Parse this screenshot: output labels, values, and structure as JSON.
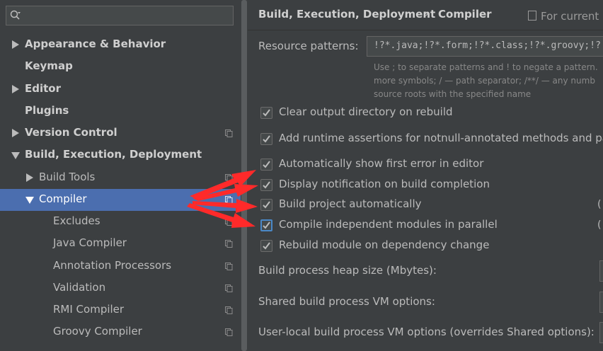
{
  "search": {
    "value": "",
    "placeholder": ""
  },
  "sidebar": {
    "items": [
      {
        "label": "Appearance & Behavior"
      },
      {
        "label": "Keymap"
      },
      {
        "label": "Editor"
      },
      {
        "label": "Plugins"
      },
      {
        "label": "Version Control"
      },
      {
        "label": "Build, Execution, Deployment"
      },
      {
        "label": "Build Tools"
      },
      {
        "label": "Compiler"
      },
      {
        "label": "Excludes"
      },
      {
        "label": "Java Compiler"
      },
      {
        "label": "Annotation Processors"
      },
      {
        "label": "Validation"
      },
      {
        "label": "RMI Compiler"
      },
      {
        "label": "Groovy Compiler"
      }
    ]
  },
  "breadcrumb": {
    "parent": "Build, Execution, Deployment",
    "separator": "›",
    "current": "Compiler",
    "scope": "For current"
  },
  "resource_patterns": {
    "label": "Resource patterns:",
    "value": "!?*.java;!?*.form;!?*.class;!?*.groovy;!?",
    "hint_line1": "Use ; to separate patterns and ! to negate a pattern.",
    "hint_line2": "more symbols; / — path separator; /**/ — any numb",
    "hint_line3": "source roots with the specified name"
  },
  "options": {
    "clear_output": "Clear output directory on rebuild",
    "runtime_assertions": "Add runtime assertions for notnull-annotated methods and par",
    "show_first_error": "Automatically show first error in editor",
    "display_notification": "Display notification on build completion",
    "build_auto": "Build project automatically",
    "compile_parallel": "Compile independent modules in parallel",
    "rebuild_module": "Rebuild module on dependency change",
    "side_note": "("
  },
  "fields": {
    "heap_size": "Build process heap size (Mbytes):",
    "shared_vm": "Shared build process VM options:",
    "user_vm": "User-local build process VM options (overrides Shared options):"
  },
  "colors": {
    "background": "#3c3f41",
    "selection": "#4b6eaf",
    "annotation_arrow": "#ff2a2a"
  }
}
